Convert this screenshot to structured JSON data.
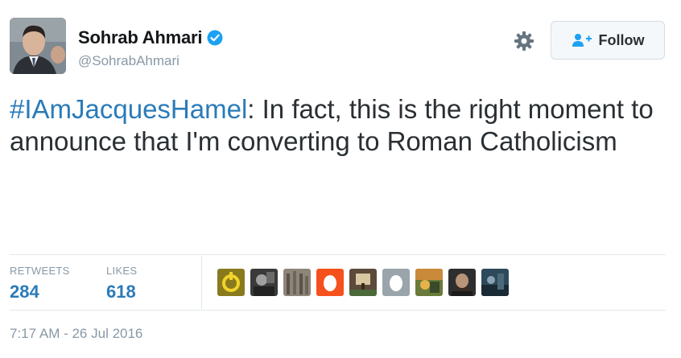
{
  "author": {
    "display_name": "Sohrab Ahmari",
    "handle": "@SohrabAhmari",
    "verified": true
  },
  "follow_button": {
    "label": "Follow",
    "icon": "add-user-icon"
  },
  "settings_icon": "gear-icon",
  "tweet": {
    "hashtag": "#IAmJacquesHamel",
    "text": ": In fact, this is the right moment to announce that I'm converting to Roman Catholicism"
  },
  "stats": {
    "retweets_label": "RETWEETS",
    "retweets_value": "284",
    "likes_label": "LIKES",
    "likes_value": "618"
  },
  "timestamp": "7:17 AM - 26 Jul 2016",
  "colors": {
    "link": "#2b7bb9",
    "muted": "#8899a6",
    "verified": "#1da1f2",
    "text": "#292f33"
  }
}
